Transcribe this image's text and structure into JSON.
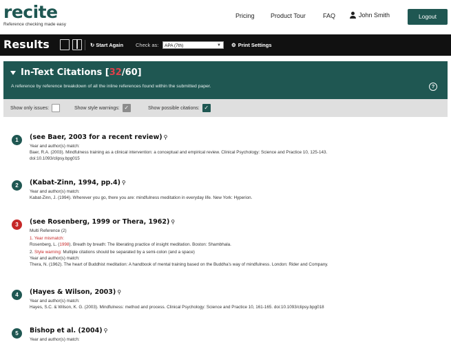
{
  "header": {
    "logo": "recite",
    "tagline": "Reference checking made easy",
    "nav": {
      "pricing": "Pricing",
      "tour": "Product Tour",
      "faq": "FAQ",
      "user": "John Smith"
    },
    "logout_label": "Logout"
  },
  "toolbar": {
    "title": "Results",
    "start_again_icon": "↻",
    "start_again_label": "Start Again",
    "check_as_label": "Check as:",
    "style_value": "APA (7th)",
    "print_icon": "⚙",
    "print_label": "Print Settings"
  },
  "panel": {
    "title": "In-Text Citations",
    "bracket_open": "[",
    "issue_count": "32",
    "slash_total": "/60",
    "bracket_close": "]",
    "description": "A reference by reference breakdown of all the inline references found within the submitted paper.",
    "help": "?"
  },
  "filters": {
    "only_issues_label": "Show only issues:",
    "only_issues_checked": false,
    "style_warnings_label": "Show style warnings:",
    "style_warnings_checked": true,
    "possible_citations_label": "Show possible citations:",
    "possible_citations_checked": true,
    "check_glyph": "✓"
  },
  "citations": [
    {
      "number": "1",
      "title": "(see Baer, 2003 for a recent review)",
      "match_label": "Year and author(s) match:",
      "reference_1": "Baer, R.A. (2003). Mindfulness training as a clinical intervention: a conceptual and empirical review. Clinical Psychology: Science and Practice 10, 125-143.",
      "reference_2": "doi:10.1093/clipsy.bpg015"
    },
    {
      "number": "2",
      "title": "(Kabat-Zinn, 1994, pp.4)",
      "match_label": "Year and author(s) match:",
      "reference_1": "Kabat-Zinn, J. (1994). Wherever you go, there you are: mindfulness meditation in everyday life. New York: Hyperion."
    },
    {
      "number": "3",
      "title": "(see Rosenberg, 1999 or Thera, 1962)",
      "multi": "Multi Reference (2)",
      "issue_1_prefix": "1.",
      "issue_1_label": "Year mismatch:",
      "ref_a_pre": "Rosenberg, L. (",
      "ref_a_year": "1998",
      "ref_a_post": "). Breath by breath: The liberating practice of insight meditation. Boston: Shambhala.",
      "issue_2_prefix": "2.",
      "issue_2_label": "Style warning:",
      "issue_2_text": "Multiple citations should be separated by a semi-colon (and a space)",
      "match_label": "Year and author(s) match:",
      "reference_b": "Thera, N. (1962). The heart of Buddhist meditation: A handbook of mental training based on the Buddha's way of mindfulness. London: Rider and Company."
    },
    {
      "number": "4",
      "title": "(Hayes & Wilson, 2003)",
      "match_label": "Year and author(s) match:",
      "reference_1": "Hayes, S.C. & Wilson, K. G. (2003). Mindfulness: method and process. Clinical Psychology: Science and Practice 10, 161-165. doi:10.1093/clipsy.bpg018"
    },
    {
      "number": "5",
      "title": "Bishop et al. (2004)",
      "match_label": "Year and author(s) match:"
    }
  ],
  "icons": {
    "search": "⚲"
  },
  "colors": {
    "brand": "#1f5752",
    "issue": "#c62828",
    "toolbar": "#111111",
    "filter_bar": "#dfdfdf"
  }
}
